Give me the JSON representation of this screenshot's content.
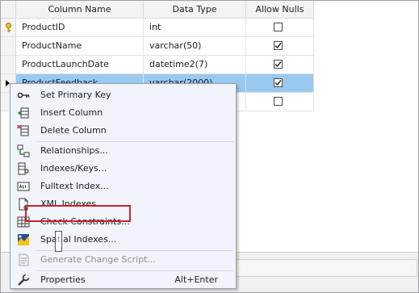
{
  "grid": {
    "headers": [
      "Column Name",
      "Data Type",
      "Allow Nulls"
    ],
    "rows": [
      {
        "name": "ProductID",
        "type": "int",
        "allow_nulls": false,
        "primary_key": true
      },
      {
        "name": "ProductName",
        "type": "varchar(50)",
        "allow_nulls": true
      },
      {
        "name": "ProductLaunchDate",
        "type": "datetime2(7)",
        "allow_nulls": true
      },
      {
        "name": "ProductFeedback",
        "type": "varchar(2000)",
        "allow_nulls": true,
        "selected": true
      },
      {
        "name": "",
        "type": "",
        "allow_nulls": false
      }
    ]
  },
  "menu": {
    "items": [
      {
        "label": "Set Primary Key",
        "icon": "key-icon"
      },
      {
        "label": "Insert Column",
        "icon": "insert-column-icon"
      },
      {
        "label": "Delete Column",
        "icon": "delete-column-icon",
        "highlighted": true
      },
      {
        "label": "Relationships...",
        "icon": "relationships-icon"
      },
      {
        "label": "Indexes/Keys...",
        "icon": "indexes-keys-icon"
      },
      {
        "label": "Fulltext Index...",
        "icon": "fulltext-index-icon"
      },
      {
        "label": "XML Indexes...",
        "icon": "xml-indexes-icon"
      },
      {
        "label": "Check Constraints...",
        "icon": "check-constraints-icon"
      },
      {
        "label": "Spatial Indexes...",
        "icon": "spatial-indexes-icon"
      },
      {
        "label": "Generate Change Script...",
        "icon": "generate-script-icon",
        "disabled": true
      },
      {
        "label": "Properties",
        "icon": "wrench-icon",
        "shortcut": "Alt+Enter"
      }
    ]
  },
  "colors": {
    "selection": "#99c9ef",
    "highlight_border": "#c8232c",
    "menu_bg": "#f2f4fb"
  }
}
